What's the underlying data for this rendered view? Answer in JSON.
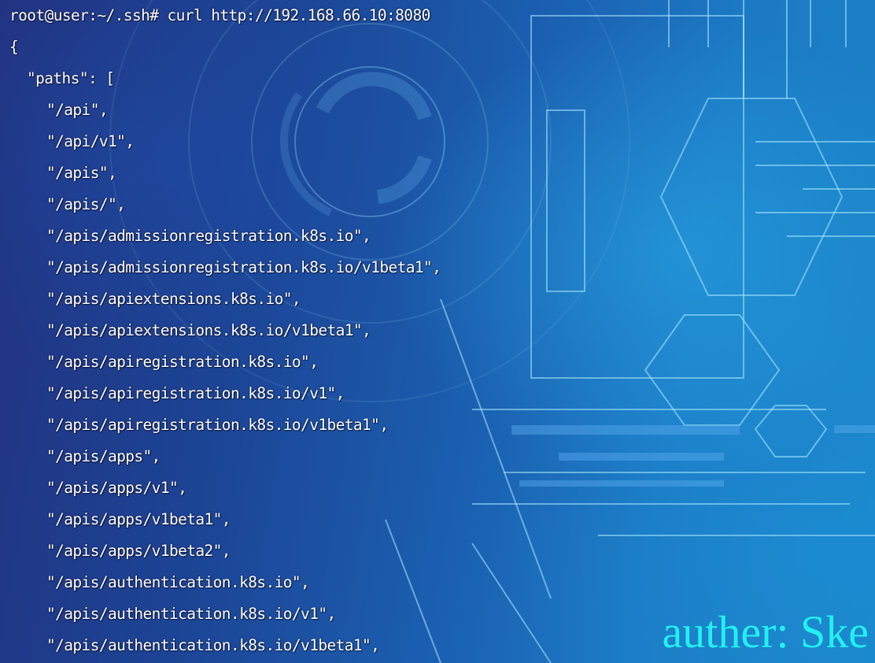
{
  "terminal": {
    "prompt": "root@user:~/.ssh#",
    "command": "curl http://192.168.66.10:8080",
    "output_lines": [
      "{",
      "\"paths\": [",
      "\"/api\",",
      "\"/api/v1\",",
      "\"/apis\",",
      "\"/apis/\",",
      "\"/apis/admissionregistration.k8s.io\",",
      "\"/apis/admissionregistration.k8s.io/v1beta1\",",
      "\"/apis/apiextensions.k8s.io\",",
      "\"/apis/apiextensions.k8s.io/v1beta1\",",
      "\"/apis/apiregistration.k8s.io\",",
      "\"/apis/apiregistration.k8s.io/v1\",",
      "\"/apis/apiregistration.k8s.io/v1beta1\",",
      "\"/apis/apps\",",
      "\"/apis/apps/v1\",",
      "\"/apis/apps/v1beta1\",",
      "\"/apis/apps/v1beta2\",",
      "\"/apis/authentication.k8s.io\",",
      "\"/apis/authentication.k8s.io/v1\",",
      "\"/apis/authentication.k8s.io/v1beta1\","
    ]
  },
  "watermark": "auther: Ske",
  "colors": {
    "text": "#ffffff",
    "watermark": "#22f0f0",
    "background": "#1c4596"
  }
}
